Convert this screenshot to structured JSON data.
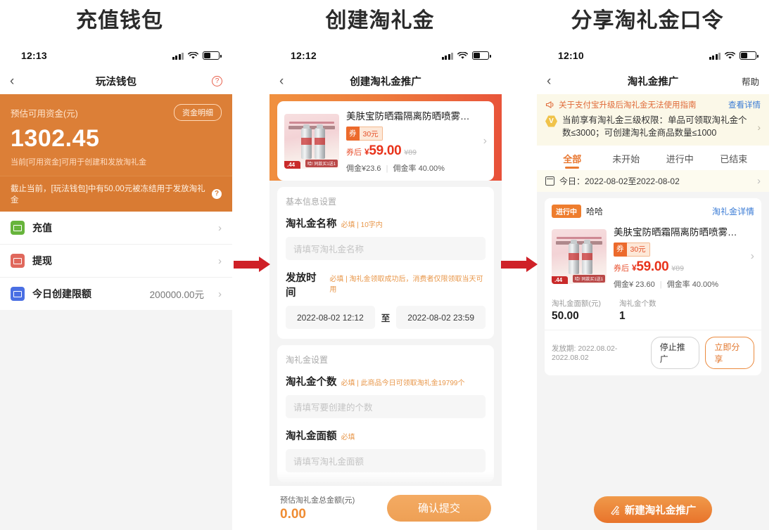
{
  "captions": {
    "panel1": "充值钱包",
    "panel2": "创建淘礼金",
    "panel3": "分享淘礼金口令"
  },
  "panel1": {
    "status": {
      "time": "12:13"
    },
    "nav": {
      "back_icon": "chevron-left-icon",
      "title": "玩法钱包",
      "help_icon": "question-mark-icon",
      "help_glyph": "?"
    },
    "hero": {
      "label": "预估可用资金(元)",
      "detail_button": "资金明细",
      "amount": "1302.45",
      "sub": "当前[可用资金]可用于创建和发放淘礼金"
    },
    "notice": {
      "text": "截止当前，[玩法钱包]中有50.00元被冻结用于发放淘礼金",
      "icon_glyph": "?"
    },
    "rows": [
      {
        "label": "充值",
        "value": "",
        "icon": "recharge-icon",
        "color": "green"
      },
      {
        "label": "提现",
        "value": "",
        "icon": "withdraw-icon",
        "color": "red"
      },
      {
        "label": "今日创建限额",
        "value": "200000.00元",
        "icon": "limit-icon",
        "color": "blue"
      }
    ],
    "chevron": "›"
  },
  "panel2": {
    "status": {
      "time": "12:12"
    },
    "nav": {
      "back_icon": "chevron-left-icon",
      "title": "创建淘礼金推广"
    },
    "product": {
      "title": "美肤宝防晒霜隔离防晒喷雾…",
      "coupon_tag": "券",
      "coupon_value": "30元",
      "price_prefix": "券后",
      "price_yen": "¥",
      "price": "59.00",
      "price_old": "¥89",
      "commission": "佣金¥23.6",
      "commission_divider": "|",
      "commission_rate": "佣金率 40.00%",
      "thumb_badge": ".44",
      "thumb_buy_tag": "哈! 同款买1送1",
      "arrow": "›"
    },
    "basic_section": {
      "section_title": "基本信息设置",
      "name_label": "淘礼金名称",
      "name_hint": "必填 | 10字内",
      "name_placeholder": "请填写淘礼金名称",
      "time_label": "发放时间",
      "time_hint": "必填 | 淘礼金领取成功后，消费者仅限领取当天可用",
      "time_start": "2022-08-02 12:12",
      "time_sep": "至",
      "time_end": "2022-08-02 23:59"
    },
    "tlj_section": {
      "section_title": "淘礼金设置",
      "count_label": "淘礼金个数",
      "count_hint": "必填 | 此商品今日可领取淘礼金19799个",
      "count_placeholder": "请填写要创建的个数",
      "amount_label": "淘礼金面额",
      "amount_hint": "必填",
      "amount_placeholder": "请填写淘礼金面额"
    },
    "footer": {
      "total_label": "预估淘礼金总金额(元)",
      "total_value": "0.00",
      "submit": "确认提交"
    }
  },
  "panel3": {
    "status": {
      "time": "12:10"
    },
    "nav": {
      "back_icon": "chevron-left-icon",
      "title": "淘礼金推广",
      "right": "帮助"
    },
    "notice1": {
      "icon": "megaphone-icon",
      "text": "关于支付宝升级后淘礼金无法使用指南",
      "link": "查看详情"
    },
    "notice2": {
      "badge": "V",
      "text": "当前享有淘礼金三级权限：单品可领取淘礼金个数≤3000；可创建淘礼金商品数量≤1000",
      "chevron": "›"
    },
    "tabs": [
      {
        "label": "全部",
        "active": true
      },
      {
        "label": "未开始",
        "active": false
      },
      {
        "label": "进行中",
        "active": false
      },
      {
        "label": "已结束",
        "active": false
      }
    ],
    "date_filter": {
      "icon": "calendar-icon",
      "text": "今日：2022-08-02至2022-08-02",
      "chevron": "›"
    },
    "promo": {
      "status": "进行中",
      "name": "哈哈",
      "detail_link": "淘礼金详情",
      "product": {
        "title": "美肤宝防晒霜隔离防晒喷雾…",
        "coupon_tag": "券",
        "coupon_value": "30元",
        "price_prefix": "券后",
        "price_yen": "¥",
        "price": "59.00",
        "price_old": "¥89",
        "commission": "佣金¥ 23.60",
        "commission_divider": "|",
        "commission_rate": "佣金率 40.00%",
        "thumb_badge": ".44",
        "thumb_buy_tag": "哈! 同款买1送1",
        "arrow": "›"
      },
      "stats": [
        {
          "key": "淘礼金面额(元)",
          "value": "50.00"
        },
        {
          "key": "淘礼金个数",
          "value": "1"
        }
      ],
      "period": "发放期: 2022.08.02-2022.08.02",
      "stop_button": "停止推广",
      "share_button": "立即分享"
    },
    "fab": {
      "icon": "edit-icon",
      "label": "新建淘礼金推广"
    }
  },
  "colors": {
    "wallet_orange": "#dc7f37",
    "gradient_start": "#f0913f",
    "gradient_end": "#e8503a",
    "accent_orange": "#e8762f",
    "arrow_red": "#cf2027",
    "link_blue": "#3a7bd5"
  }
}
